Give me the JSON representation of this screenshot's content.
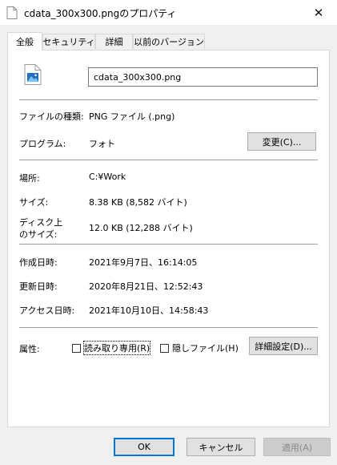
{
  "window": {
    "title": "cdata_300x300.pngのプロパティ",
    "close_glyph": "✕"
  },
  "tabs": [
    {
      "label": "全般",
      "active": true
    },
    {
      "label": "セキュリティ"
    },
    {
      "label": "詳細"
    },
    {
      "label": "以前のバージョン"
    }
  ],
  "file": {
    "name": "cdata_300x300.png",
    "icon": "image-file-icon"
  },
  "rows": {
    "type": {
      "label": "ファイルの種類:",
      "value": "PNG ファイル (.png)"
    },
    "program": {
      "label": "プログラム:",
      "value": "フォト",
      "button": "変更(C)..."
    },
    "location": {
      "label": "場所:",
      "value": "C:¥Work"
    },
    "size": {
      "label": "サイズ:",
      "value": "8.38 KB (8,582 バイト)"
    },
    "disk_size": {
      "label_line1": "ディスク上",
      "label_line2": "のサイズ:",
      "value": "12.0 KB (12,288 バイト)"
    },
    "created": {
      "label": "作成日時:",
      "value": "2021年9月7日、16:14:05"
    },
    "modified": {
      "label": "更新日時:",
      "value": "2020年8月21日、12:52:43"
    },
    "accessed": {
      "label": "アクセス日時:",
      "value": "2021年10月10日、14:58:43"
    }
  },
  "attributes": {
    "label": "属性:",
    "readonly": {
      "label": "読み取り専用(R)",
      "checked": false
    },
    "hidden": {
      "label": "隠しファイル(H)",
      "checked": false
    },
    "advanced_button": "詳細設定(D)..."
  },
  "footer": {
    "ok": "OK",
    "cancel": "キャンセル",
    "apply": "適用(A)"
  },
  "colors": {
    "accent": "#0078d7",
    "background": "#f0f0f0"
  }
}
